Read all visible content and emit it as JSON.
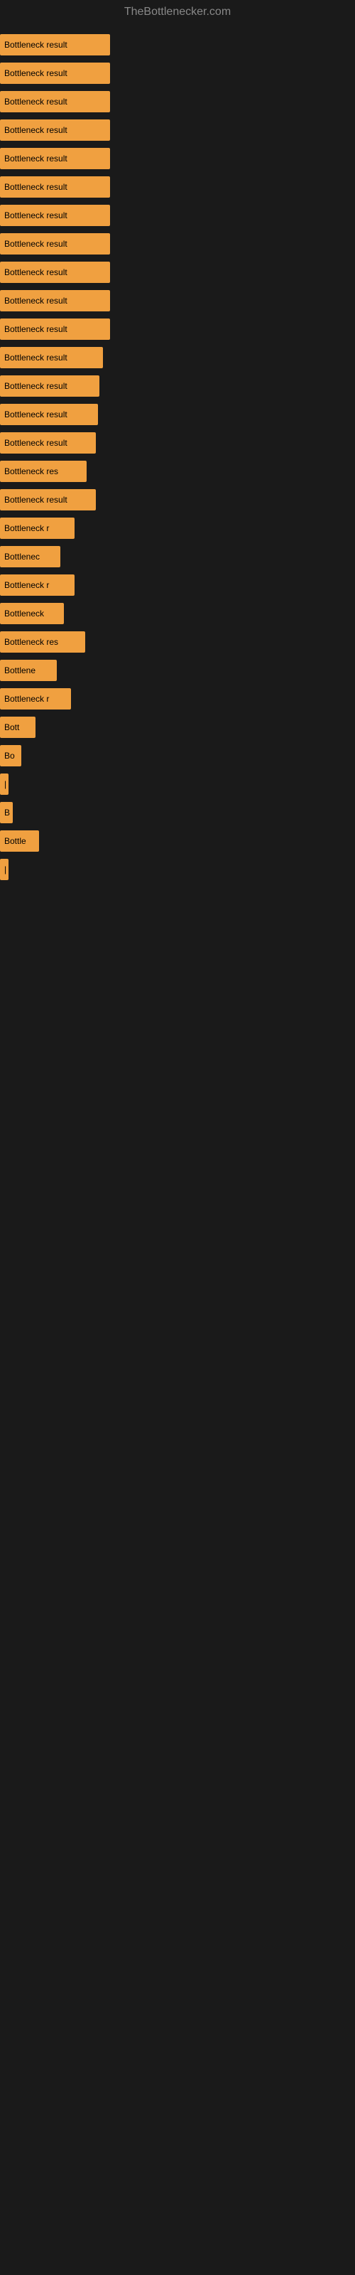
{
  "header": {
    "title": "TheBottlenecker.com"
  },
  "bars": [
    {
      "label": "Bottleneck result",
      "width": 155
    },
    {
      "label": "Bottleneck result",
      "width": 155
    },
    {
      "label": "Bottleneck result",
      "width": 155
    },
    {
      "label": "Bottleneck result",
      "width": 155
    },
    {
      "label": "Bottleneck result",
      "width": 155
    },
    {
      "label": "Bottleneck result",
      "width": 155
    },
    {
      "label": "Bottleneck result",
      "width": 155
    },
    {
      "label": "Bottleneck result",
      "width": 155
    },
    {
      "label": "Bottleneck result",
      "width": 155
    },
    {
      "label": "Bottleneck result",
      "width": 155
    },
    {
      "label": "Bottleneck result",
      "width": 155
    },
    {
      "label": "Bottleneck result",
      "width": 145
    },
    {
      "label": "Bottleneck result",
      "width": 140
    },
    {
      "label": "Bottleneck result",
      "width": 138
    },
    {
      "label": "Bottleneck result",
      "width": 135
    },
    {
      "label": "Bottleneck res",
      "width": 122
    },
    {
      "label": "Bottleneck result",
      "width": 135
    },
    {
      "label": "Bottleneck r",
      "width": 105
    },
    {
      "label": "Bottlenec",
      "width": 85
    },
    {
      "label": "Bottleneck r",
      "width": 105
    },
    {
      "label": "Bottleneck",
      "width": 90
    },
    {
      "label": "Bottleneck res",
      "width": 120
    },
    {
      "label": "Bottlene",
      "width": 80
    },
    {
      "label": "Bottleneck r",
      "width": 100
    },
    {
      "label": "Bott",
      "width": 50
    },
    {
      "label": "Bo",
      "width": 30
    },
    {
      "label": "|",
      "width": 12
    },
    {
      "label": "B",
      "width": 18
    },
    {
      "label": "Bottle",
      "width": 55
    },
    {
      "label": "|",
      "width": 12
    }
  ]
}
